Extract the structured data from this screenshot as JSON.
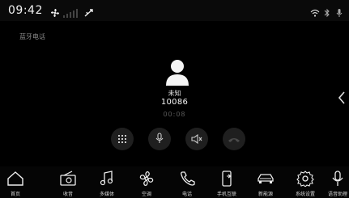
{
  "status_bar": {
    "time": "09:42",
    "left_icons": [
      "fan-icon",
      "signal-bars-icon",
      "usb-icon"
    ],
    "right_icons": [
      "wifi-icon",
      "bluetooth-icon",
      "microphone-icon"
    ]
  },
  "section_title": "蓝牙电话",
  "caller": {
    "name": "未知",
    "number": "10086",
    "timer": "00:08",
    "avatar_icon": "person-avatar-icon"
  },
  "call_controls": [
    {
      "name": "keypad-button",
      "icon": "keypad-icon"
    },
    {
      "name": "mute-button",
      "icon": "microphone-icon"
    },
    {
      "name": "speaker-button",
      "icon": "speaker-icon"
    },
    {
      "name": "hangup-button",
      "icon": "hangup-icon"
    }
  ],
  "dock": {
    "items": [
      {
        "label": "首页",
        "icon": "home-icon"
      },
      {
        "label": "收音",
        "icon": "radio-icon"
      },
      {
        "label": "多媒体",
        "icon": "music-icon"
      },
      {
        "label": "空调",
        "icon": "fan-icon"
      },
      {
        "label": "电话",
        "icon": "phone-icon"
      },
      {
        "label": "手机互联",
        "icon": "phone-link-icon"
      },
      {
        "label": "新能源",
        "icon": "car-icon"
      },
      {
        "label": "系统设置",
        "icon": "gear-icon"
      },
      {
        "label": "语音助理",
        "icon": "voice-assistant-icon"
      }
    ]
  },
  "colors": {
    "background": "#000000",
    "dock_background": "#050505",
    "control_background": "#1f1f1f",
    "text_primary": "#f5f5f5",
    "text_muted": "#8a8a8a"
  }
}
